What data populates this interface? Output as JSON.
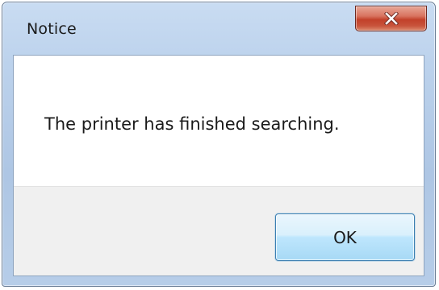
{
  "window": {
    "title": "Notice"
  },
  "message": {
    "text": "The printer has finished searching."
  },
  "buttons": {
    "ok_label": "OK"
  },
  "icons": {
    "close": "close-icon"
  },
  "colors": {
    "titlebar": "#bcd2ec",
    "close_button": "#c2412a",
    "button_area": "#f0f0f0",
    "ok_button": "#bee6fd"
  }
}
